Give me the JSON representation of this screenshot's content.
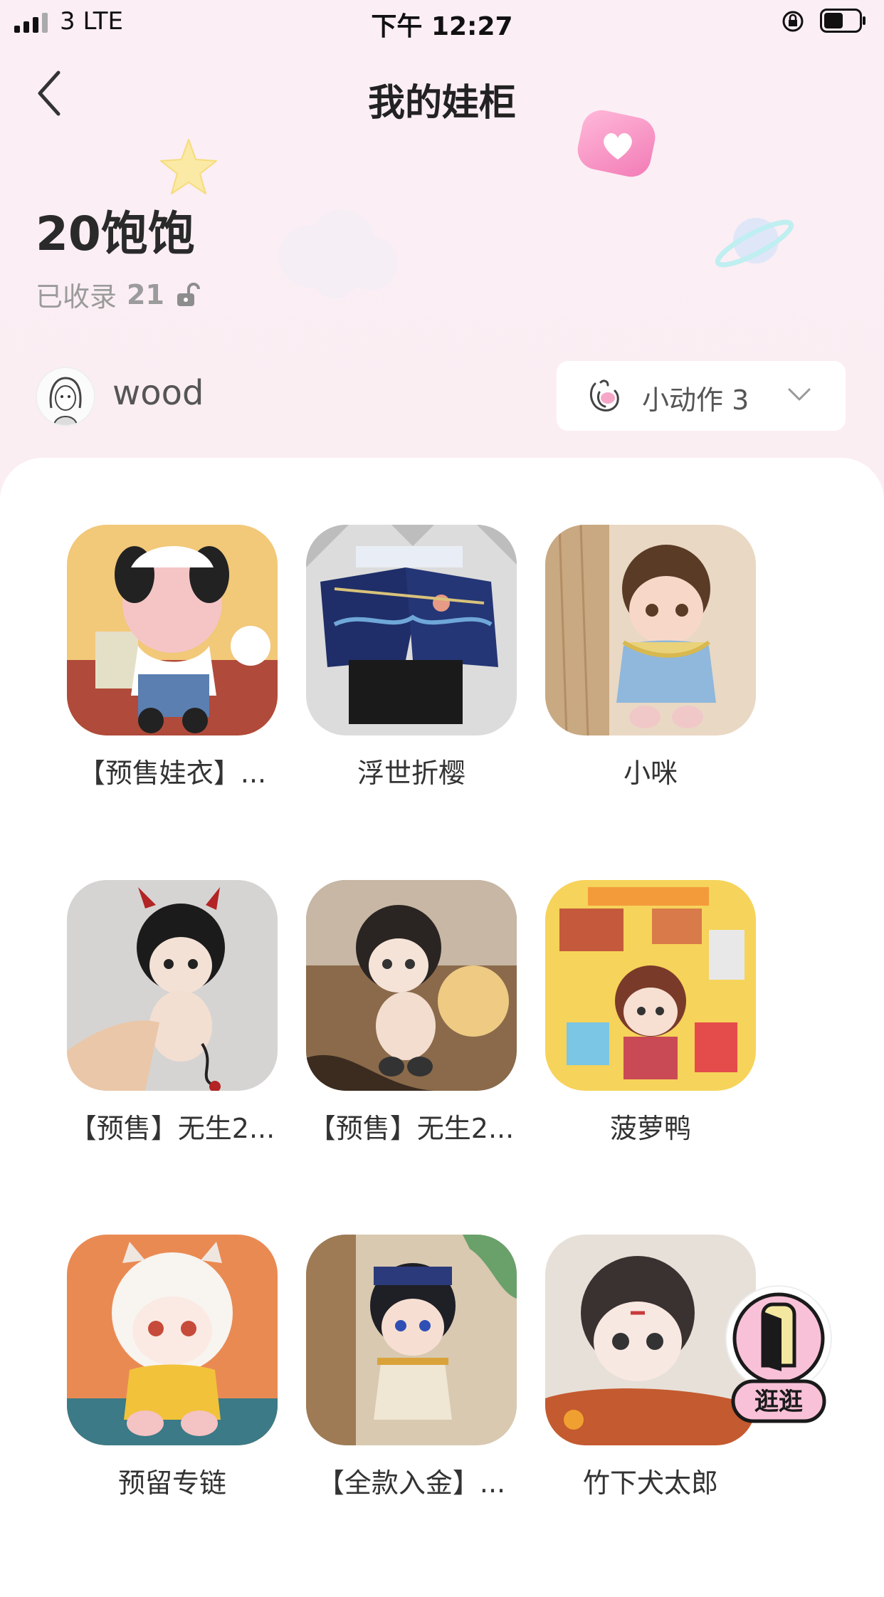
{
  "status_bar": {
    "carrier": "3  LTE",
    "time": "下午 12:27"
  },
  "header": {
    "title": "我的娃柜"
  },
  "cabinet": {
    "name": "20饱饱",
    "collected_label": "已收录",
    "collected_count": "21"
  },
  "owner": {
    "name": "wood"
  },
  "action": {
    "label": "小动作 3"
  },
  "items": [
    {
      "label": "【预售娃衣】..."
    },
    {
      "label": "浮世折樱"
    },
    {
      "label": "小咪"
    },
    {
      "label": "【预售】无生2..."
    },
    {
      "label": "【预售】无生2..."
    },
    {
      "label": "菠萝鸭"
    },
    {
      "label": "预留专链"
    },
    {
      "label": "【全款入金】..."
    },
    {
      "label": "竹下犬太郎"
    }
  ],
  "fab": {
    "label": "逛逛"
  }
}
